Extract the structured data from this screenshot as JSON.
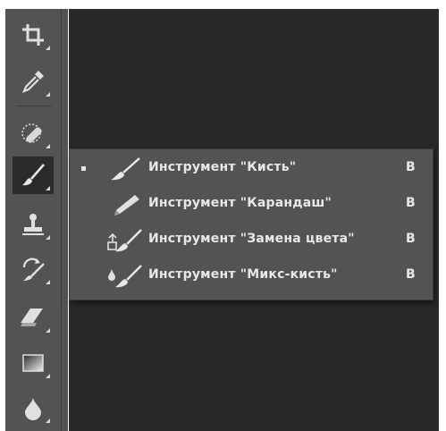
{
  "toolbar": {
    "tools": [
      {
        "icon": "crop-icon"
      },
      {
        "icon": "eyedropper-icon"
      },
      {
        "icon": "healing-brush-icon"
      },
      {
        "icon": "brush-icon",
        "active": true
      },
      {
        "icon": "clone-stamp-icon"
      },
      {
        "icon": "history-brush-icon"
      },
      {
        "icon": "eraser-icon"
      },
      {
        "icon": "gradient-icon"
      },
      {
        "icon": "blur-drop-icon"
      }
    ]
  },
  "flyout": {
    "items": [
      {
        "label": "Инструмент \"Кисть\"",
        "shortcut": "B",
        "icon": "brush-icon",
        "selected": true
      },
      {
        "label": "Инструмент \"Карандаш\"",
        "shortcut": "B",
        "icon": "pencil-icon",
        "selected": false
      },
      {
        "label": "Инструмент \"Замена цвета\"",
        "shortcut": "B",
        "icon": "color-replacement-icon",
        "selected": false
      },
      {
        "label": "Инструмент \"Микс-кисть\"",
        "shortcut": "B",
        "icon": "mixer-brush-icon",
        "selected": false
      }
    ]
  },
  "colors": {
    "panel": "#535353",
    "canvas": "#282828",
    "text": "#e8e8e8"
  }
}
